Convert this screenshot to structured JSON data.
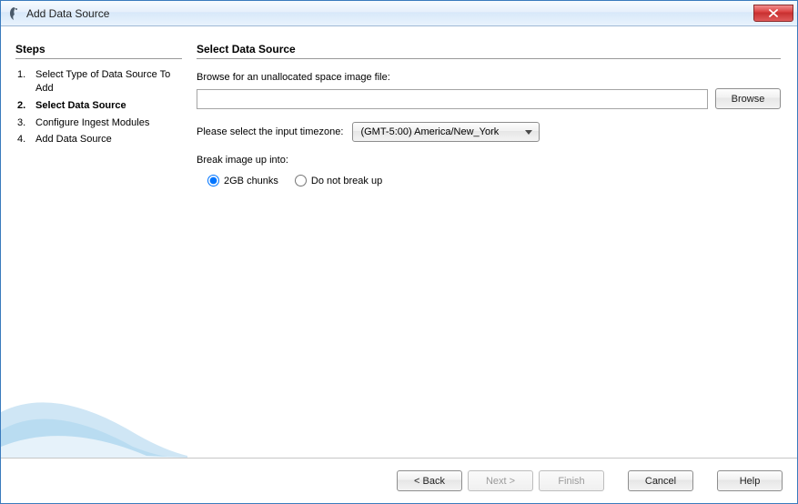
{
  "window": {
    "title": "Add Data Source"
  },
  "left": {
    "heading": "Steps",
    "steps": [
      {
        "num": "1.",
        "label": "Select Type of Data Source To Add"
      },
      {
        "num": "2.",
        "label": "Select Data Source"
      },
      {
        "num": "3.",
        "label": "Configure Ingest Modules"
      },
      {
        "num": "4.",
        "label": "Add Data Source"
      }
    ],
    "currentIndex": 1
  },
  "right": {
    "heading": "Select Data Source",
    "browseLabel": "Browse for an unallocated space image file:",
    "pathValue": "",
    "browseButton": "Browse",
    "tzLabel": "Please select the input timezone:",
    "tzValue": "(GMT-5:00) America/New_York",
    "breakLabel": "Break image up into:",
    "radioA": "2GB chunks",
    "radioB": "Do not break up"
  },
  "footer": {
    "back": "< Back",
    "next": "Next >",
    "finish": "Finish",
    "cancel": "Cancel",
    "help": "Help"
  }
}
